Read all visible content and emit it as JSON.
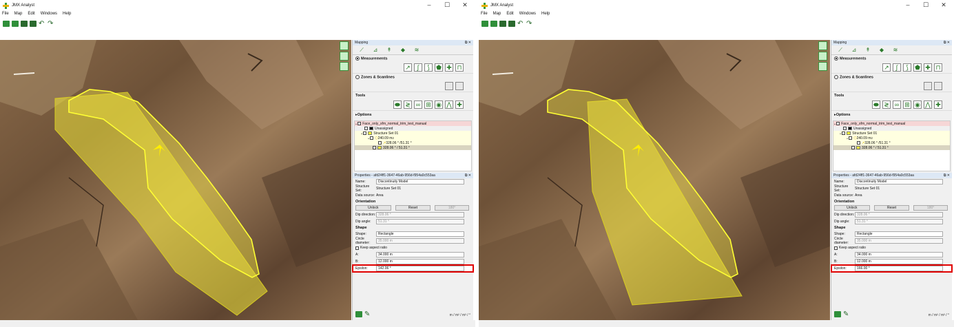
{
  "app": {
    "title": "JMX Analyst"
  },
  "window_controls": [
    "–",
    "☐",
    "✕"
  ],
  "menu": [
    "File",
    "Map",
    "Edit",
    "Windows",
    "Help"
  ],
  "toolbar_icons": [
    "open-folder-icon",
    "open-folder-icon",
    "save-icon",
    "print-icon",
    "undo-icon",
    "redo-icon"
  ],
  "undo_glyph": "↶",
  "redo_glyph": "↷",
  "colors": {
    "accent": "#2f8f3a",
    "polygon_fill": "#f0e63a",
    "outline": "#ffff33",
    "highlight_border": "#e00000",
    "tree_highlight": "#f6d6d6"
  },
  "mapping": {
    "header": "Mapping",
    "header_controls": "⧉ ✕",
    "tabs": [
      "⟋",
      "⊿",
      "↟",
      "◆",
      "≋"
    ],
    "measurements_label": "Measurements",
    "zones_label": "Zones & Scanlines",
    "tools_label": "Tools",
    "options_label": "Options",
    "measurement_tools": [
      "↗",
      "∫",
      "⟆",
      "⬟",
      "✚",
      "⊓"
    ],
    "tool_tools": [
      "⬬",
      "≷",
      "∞",
      "⊞",
      "◉",
      "⋀",
      "✚"
    ]
  },
  "tree": {
    "root": "Face_only_sfm_normal_trim_test_manual",
    "unassigned": "Unassigned",
    "structure_set": "Structure Set 01",
    "area_left": "240.09 m",
    "area_right": "240.09 m",
    "area_sup": "2",
    "orient": "328.06 ° /51.31 °",
    "disc": "328.06 ° / 51.31 °"
  },
  "properties": {
    "header_left": "Properties - afd24ff1-3647-46ab-956d-f954a0c553aa",
    "header_right": "Properties - afd24ff1-3647-46ab-956d-f954a0c553aa",
    "name_label": "Name:",
    "name_value": "Discontinuity Model",
    "structure_label": "Structure Set:",
    "structure_value": "Structure Set 01",
    "source_label": "Data source:",
    "source_value": "Area",
    "orientation_label": "Orientation",
    "unlock": "Unlock",
    "reset": "Reset",
    "rotate": "180°",
    "dipdir_label": "Dip direction:",
    "dipdir_value": "328.06 °",
    "dipangle_label": "Dip angle:",
    "dipangle_value": "51.31 °",
    "shape_section": "Shape",
    "shape_label": "Shape:",
    "shape_value": "Rectangle",
    "circle_label": "Circle diameter:",
    "circle_value": "35.000 m",
    "keep_aspect": "Keep aspect ratio",
    "a_label": "A:",
    "a_value": "34.000 m",
    "b_label": "B:",
    "b_value": "12.000 m",
    "epsilon_label": "Epsilon:",
    "epsilon_left": "142.06 °",
    "epsilon_right": "166.00 °"
  },
  "units": "m / m² / m³ / °"
}
